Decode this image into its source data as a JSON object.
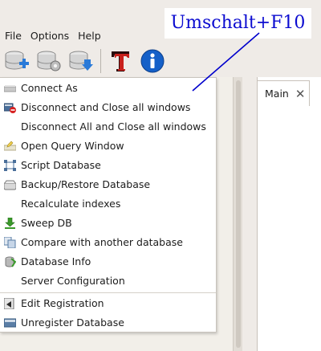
{
  "annotation": {
    "text": "Umschalt+F10"
  },
  "menubar": {
    "file": "File",
    "options": "Options",
    "help": "Help"
  },
  "toolbar": {
    "buttons": [
      "database-add-icon",
      "database-settings-icon",
      "database-download-icon",
      "text-tool-icon",
      "info-icon"
    ]
  },
  "tab": {
    "label": "Main"
  },
  "context_menu": {
    "items": [
      {
        "label": "Connect As",
        "icon": "connect-icon"
      },
      {
        "label": "Disconnect and Close all windows",
        "icon": "disconnect-icon"
      },
      {
        "label": "Disconnect All and Close all windows",
        "icon": ""
      },
      {
        "label": "Open Query Window",
        "icon": "query-window-icon"
      },
      {
        "label": "Script Database",
        "icon": "script-icon"
      },
      {
        "label": "Backup/Restore Database",
        "icon": "backup-icon"
      },
      {
        "label": "Recalculate indexes",
        "icon": ""
      },
      {
        "label": "Sweep DB",
        "icon": "sweep-icon"
      },
      {
        "label": "Compare with another database",
        "icon": "compare-icon"
      },
      {
        "label": "Database Info",
        "icon": "database-info-icon"
      },
      {
        "label": "Server Configuration",
        "icon": ""
      },
      {
        "label": "Edit Registration",
        "icon": "edit-registration-icon"
      },
      {
        "label": "Unregister Database",
        "icon": "unregister-icon"
      }
    ]
  },
  "colors": {
    "annotation_text": "#0b0bd0",
    "arrow": "#0000cc",
    "info_blue": "#1560c8",
    "tool_red": "#c8201b"
  }
}
